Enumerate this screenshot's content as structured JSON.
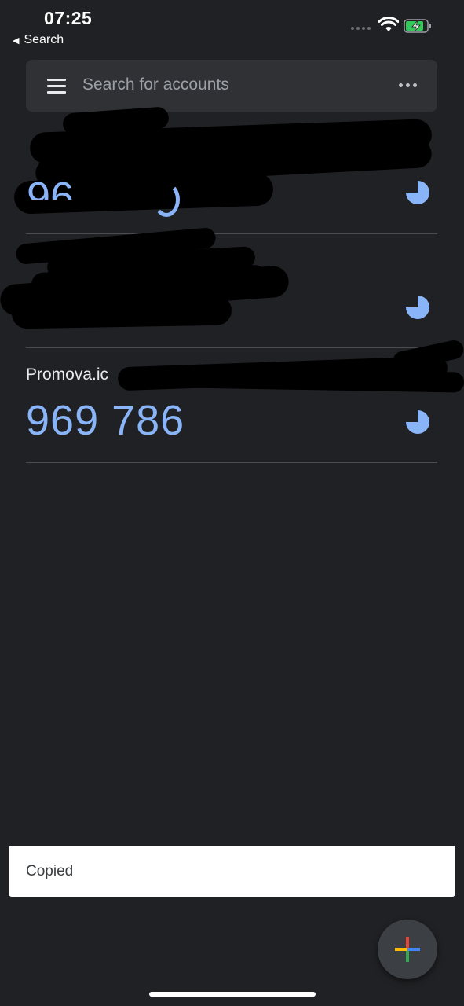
{
  "status_bar": {
    "time": "07:25",
    "back_label": "Search"
  },
  "search": {
    "placeholder": "Search for accounts",
    "menu_icon": "hamburger-menu-icon",
    "more_icon": "more-horizontal-icon"
  },
  "accounts": [
    {
      "name": "",
      "code": "",
      "redacted": true
    },
    {
      "name": "",
      "code": "",
      "redacted": true
    },
    {
      "name": "Promova.ic",
      "code": "969 786",
      "redacted": false
    }
  ],
  "toast": {
    "text": "Copied"
  },
  "fab": {
    "icon": "add-plus-icon"
  },
  "colors": {
    "background": "#202124",
    "code": "#8ab4f8",
    "search_bar": "#303134",
    "fab_red": "#ea4335",
    "fab_blue": "#4285f4",
    "fab_green": "#34a853",
    "fab_yellow": "#fbbc04"
  }
}
